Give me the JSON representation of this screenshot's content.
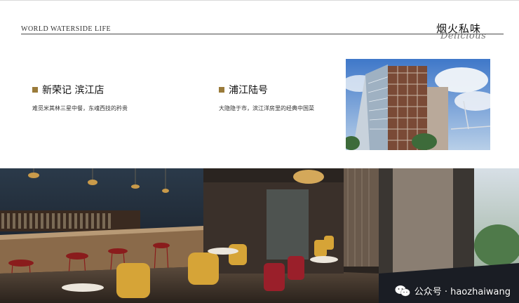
{
  "header": {
    "brand_line": "WORLD WATERSIDE LIFE",
    "title_cn": "烟火私味",
    "title_script": "Delicious"
  },
  "panels": [
    {
      "name": "新荣记 滨江店",
      "desc": "难觅米其林三星中餐，东魂西技的矜贵"
    },
    {
      "name": "浦江陆号",
      "desc": "大隐隐于市，滨江洋房里的经典中国菜"
    }
  ],
  "watermark": {
    "text": "公众号 · haozhaiwang"
  },
  "colors": {
    "accent": "#9a7b3a",
    "divider": "#4a4a4a"
  },
  "icons": {
    "panel_marker": "square-marker-icon",
    "watermark_icon": "wechat-logo-icon"
  }
}
